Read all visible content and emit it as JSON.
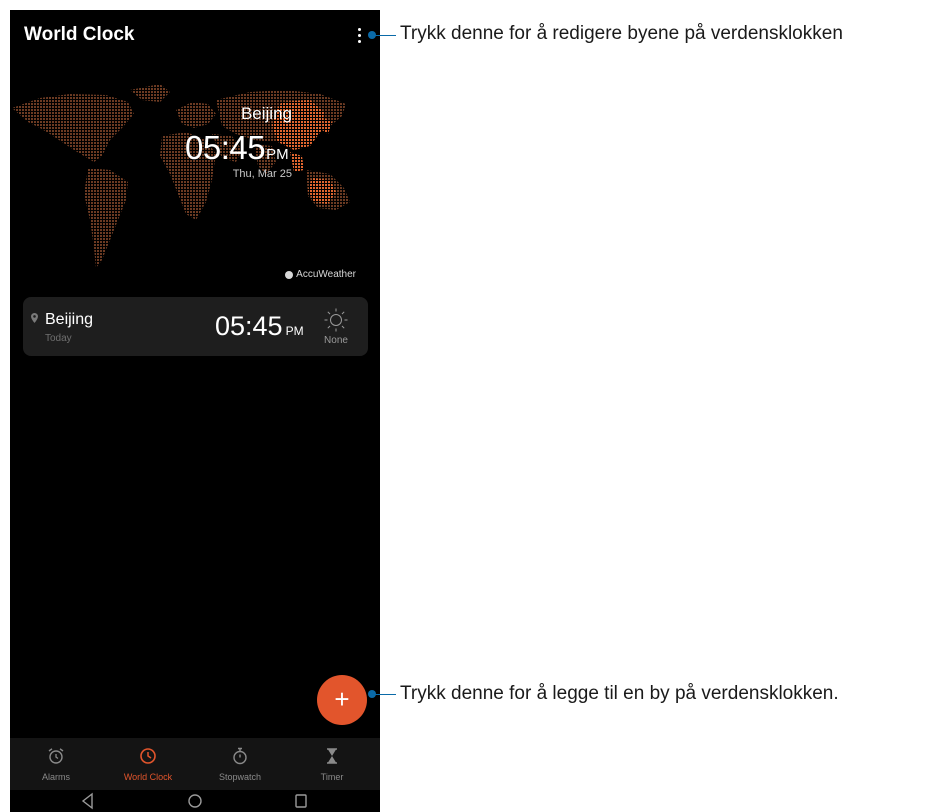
{
  "app": {
    "title": "World Clock"
  },
  "hero": {
    "city": "Beijing",
    "time": "05:45",
    "ampm": "PM",
    "date": "Thu, Mar 25"
  },
  "brand": {
    "name": "AccuWeather"
  },
  "city_card": {
    "city": "Beijing",
    "day": "Today",
    "time": "05:45",
    "ampm": "PM",
    "weather": "None"
  },
  "fab": {
    "label": "+"
  },
  "nav": {
    "alarms": "Alarms",
    "world_clock": "World Clock",
    "stopwatch": "Stopwatch",
    "timer": "Timer"
  },
  "callouts": {
    "menu": "Trykk denne for å redigere byene på verdensklokken",
    "add": "Trykk denne for å legge til en by på verdensklokken."
  },
  "colors": {
    "accent": "#e2552c",
    "callout": "#0a6aa8",
    "map_dots": "#6b3a22",
    "map_highlight": "#e2662f"
  }
}
